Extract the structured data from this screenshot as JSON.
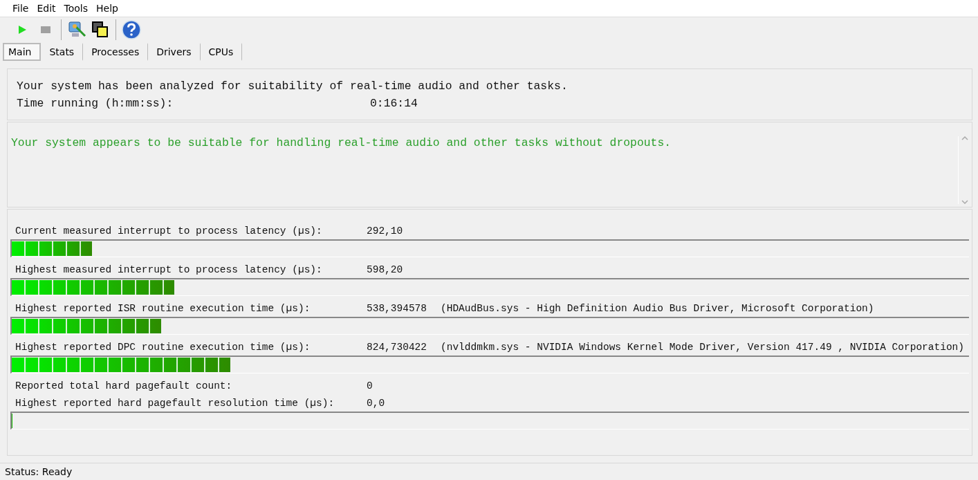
{
  "menu": [
    {
      "label": "File"
    },
    {
      "label": "Edit"
    },
    {
      "label": "Tools"
    },
    {
      "label": "Help"
    }
  ],
  "toolbar": [
    {
      "kind": "play",
      "disabled": false
    },
    {
      "kind": "stop",
      "disabled": true
    },
    {
      "kind": "separator"
    },
    {
      "kind": "monitor"
    },
    {
      "kind": "windows"
    },
    {
      "kind": "separator"
    },
    {
      "kind": "help"
    }
  ],
  "tabs": [
    {
      "label": "Main",
      "selected": true
    },
    {
      "label": "Stats",
      "selected": false
    },
    {
      "label": "Processes",
      "selected": false
    },
    {
      "label": "Drivers",
      "selected": false
    },
    {
      "label": "CPUs",
      "selected": false
    }
  ],
  "summary": {
    "line": "Your system has been analyzed for suitability of real-time audio and other tasks.",
    "time_label": "Time running (h:mm:ss):",
    "time_value": "0:16:14"
  },
  "verdict": {
    "text": "Your system appears to be suitable for handling real-time audio and other tasks without dropouts.",
    "color": "#2ca02c"
  },
  "measurements": [
    {
      "kind": "meter",
      "label": "Current measured interrupt to process latency (µs):",
      "value": "292,10",
      "level": 0.084
    },
    {
      "kind": "meter",
      "label": "Highest measured interrupt to process latency (µs):",
      "value": "598,20",
      "level": 0.17
    },
    {
      "kind": "meter",
      "label": "Highest reported ISR routine execution time (µs):",
      "value": "538,394578",
      "detail": "(HDAudBus.sys - High Definition Audio Bus Driver, Microsoft Corporation)",
      "level": 0.156
    },
    {
      "kind": "meter",
      "label": "Highest reported DPC routine execution time (µs):",
      "value": "824,730422",
      "detail": "(nvlddmkm.sys - NVIDIA Windows Kernel Mode Driver, Version 417.49 , NVIDIA Corporation)",
      "level": 0.228
    },
    {
      "kind": "text",
      "label": "Reported total hard pagefault count:",
      "value": "0"
    },
    {
      "kind": "meter",
      "label": "Highest reported hard pagefault resolution time (µs):",
      "value": "0,0",
      "level": 0
    }
  ],
  "status_bar": "Status: Ready"
}
